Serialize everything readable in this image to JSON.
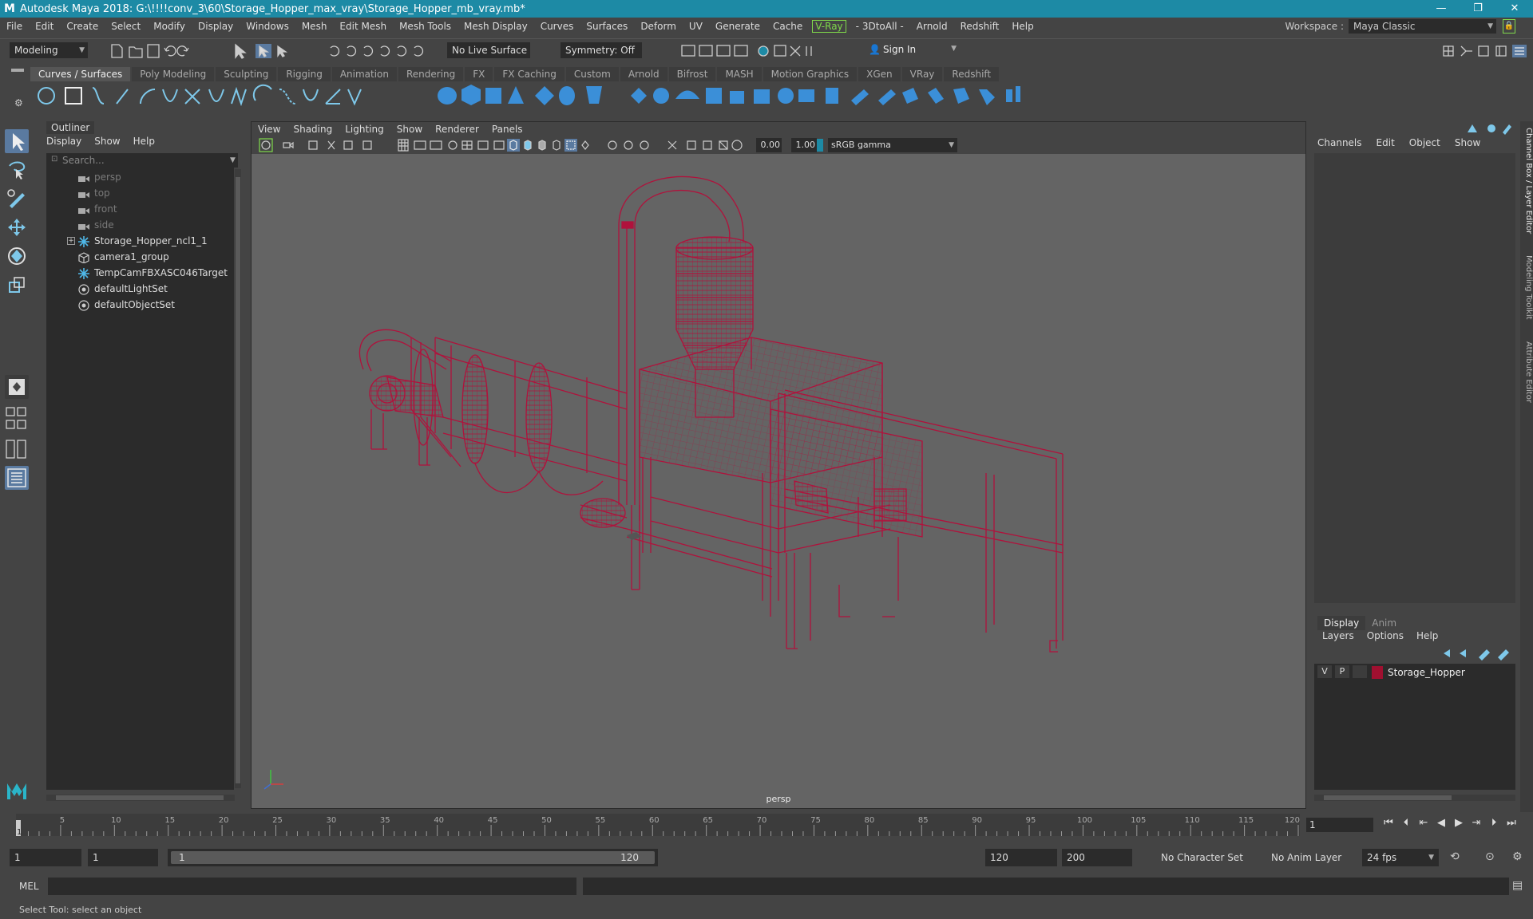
{
  "titlebar": {
    "title": "Autodesk Maya 2018: G:\\!!!!conv_3\\60\\Storage_Hopper_max_vray\\Storage_Hopper_mb_vray.mb*",
    "minimize": "—",
    "maximize": "❐",
    "close": "✕"
  },
  "menubar": {
    "items": [
      "File",
      "Edit",
      "Create",
      "Select",
      "Modify",
      "Display",
      "Windows",
      "Mesh",
      "Edit Mesh",
      "Mesh Tools",
      "Mesh Display",
      "Curves",
      "Surfaces",
      "Deform",
      "UV",
      "Generate",
      "Cache",
      "V-Ray",
      "- 3DtoAll -",
      "Arnold",
      "Redshift",
      "Help"
    ],
    "workspace_label": "Workspace :",
    "workspace_value": "Maya Classic"
  },
  "statusline": {
    "mode": "Modeling",
    "live_surface": "No Live Surface",
    "symmetry": "Symmetry: Off",
    "sign_in": "Sign In"
  },
  "shelf": {
    "tabs": [
      "Curves / Surfaces",
      "Poly Modeling",
      "Sculpting",
      "Rigging",
      "Animation",
      "Rendering",
      "FX",
      "FX Caching",
      "Custom",
      "Arnold",
      "Bifrost",
      "MASH",
      "Motion Graphics",
      "XGen",
      "VRay",
      "Redshift"
    ],
    "active_tab": "Curves / Surfaces"
  },
  "outliner": {
    "title": "Outliner",
    "menu": [
      "Display",
      "Show",
      "Help"
    ],
    "search_placeholder": "Search...",
    "items": [
      {
        "label": "persp",
        "icon": "camera-icon",
        "dim": true
      },
      {
        "label": "top",
        "icon": "camera-icon",
        "dim": true
      },
      {
        "label": "front",
        "icon": "camera-icon",
        "dim": true
      },
      {
        "label": "side",
        "icon": "camera-icon",
        "dim": true
      },
      {
        "label": "Storage_Hopper_ncl1_1",
        "icon": "transform-icon",
        "dim": false,
        "expandable": true
      },
      {
        "label": "camera1_group",
        "icon": "group-icon",
        "dim": false
      },
      {
        "label": "TempCamFBXASC046Target",
        "icon": "transform-icon",
        "dim": false
      },
      {
        "label": "defaultLightSet",
        "icon": "set-icon",
        "dim": false
      },
      {
        "label": "defaultObjectSet",
        "icon": "set-icon",
        "dim": false
      }
    ]
  },
  "viewport": {
    "menu": [
      "View",
      "Shading",
      "Lighting",
      "Show",
      "Renderer",
      "Panels"
    ],
    "exposure": "0.00",
    "gamma": "1.00",
    "color_space": "sRGB gamma",
    "camera_label": "persp",
    "wire_color": "#b0123c",
    "background_color": "#646464"
  },
  "channelbox": {
    "menu": [
      "Channels",
      "Edit",
      "Object",
      "Show"
    ]
  },
  "layers": {
    "tabs": [
      "Display",
      "Anim"
    ],
    "active_tab": "Display",
    "menu": [
      "Layers",
      "Options",
      "Help"
    ],
    "rows": [
      {
        "v": "V",
        "p": "P",
        "name": "Storage_Hopper",
        "color": "#a01030"
      }
    ]
  },
  "sidetabs": [
    "Channel Box / Layer Editor",
    "Modeling Toolkit",
    "Attribute Editor"
  ],
  "timeline": {
    "ticks": [
      "5",
      "10",
      "15",
      "20",
      "25",
      "30",
      "35",
      "40",
      "45",
      "50",
      "55",
      "60",
      "65",
      "70",
      "75",
      "80",
      "85",
      "90",
      "95",
      "100",
      "105",
      "110",
      "115",
      "120"
    ],
    "start_marker": "1",
    "current_frame": "1"
  },
  "range": {
    "start": "1",
    "playback_start": "1",
    "slider_start": "1",
    "slider_end": "120",
    "playback_end": "120",
    "end": "200",
    "character_set": "No Character Set",
    "anim_layer": "No Anim Layer",
    "fps": "24 fps"
  },
  "cmdline": {
    "label": "MEL"
  },
  "helpline": {
    "text": "Select Tool: select an object"
  }
}
